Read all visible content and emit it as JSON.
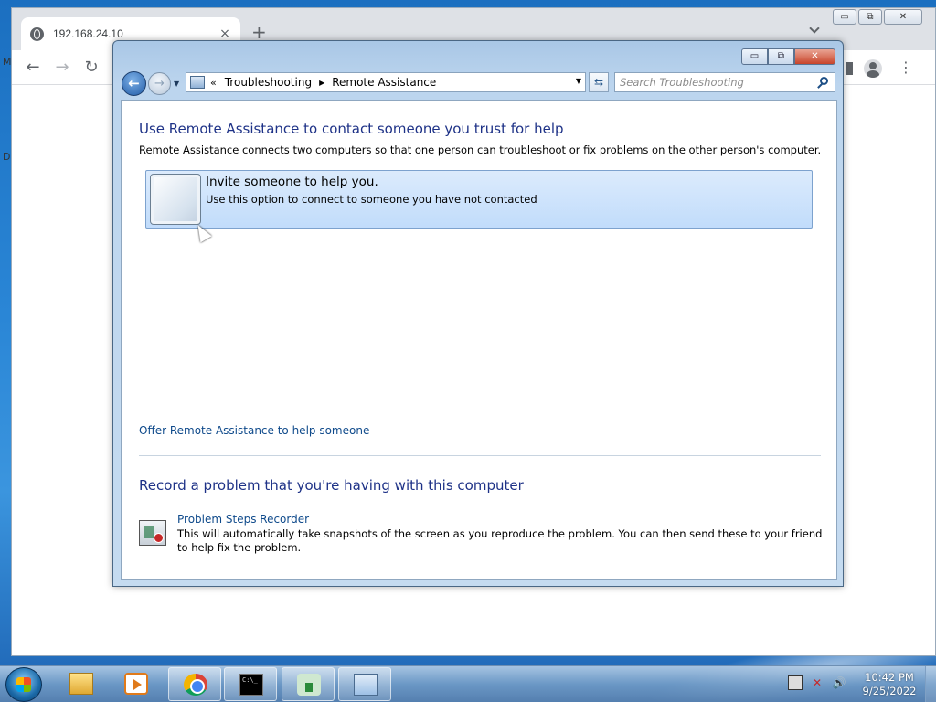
{
  "browser": {
    "tab_title": "192.168.24.10",
    "tab_close": "×",
    "new_tab": "+",
    "tab_search": "",
    "back": "←",
    "forward": "→",
    "reload": "↻",
    "menu": "⋮",
    "edge_letters": [
      "M",
      "D"
    ],
    "window_controls": {
      "minimize": "▭",
      "maximize": "⧉",
      "close": "✕"
    }
  },
  "explorer": {
    "window_controls": {
      "minimize": "▭",
      "maximize": "⧉",
      "close": "✕"
    },
    "back_glyph": "←",
    "forward_glyph": "→",
    "history_dropdown": "▼",
    "address": {
      "overflow": "«",
      "crumbs": [
        "Troubleshooting",
        "Remote Assistance"
      ],
      "separator": "▶",
      "dropdown": "▼"
    },
    "refresh_glyph": "⇆",
    "search": {
      "placeholder": "Search Troubleshooting",
      "value": ""
    },
    "content": {
      "heading": "Use Remote Assistance to contact someone you trust for help",
      "description": "Remote Assistance connects two computers so that one person can troubleshoot or fix problems on the other person's computer.",
      "invite": {
        "title": "Invite someone to help you.",
        "subtitle": "Use this option to connect to someone you have not contacted"
      },
      "offer_link": "Offer Remote Assistance to help someone",
      "record_heading": "Record a problem that you're having with this computer",
      "psr_link": "Problem Steps Recorder",
      "psr_description": "This will automatically take snapshots of the screen as you reproduce the problem. You can then send these to your friend to help fix the problem."
    }
  },
  "taskbar": {
    "items": [
      {
        "name": "windows-explorer",
        "icon": "folder-icon",
        "active": false
      },
      {
        "name": "media-player",
        "icon": "media-player-icon",
        "active": false
      },
      {
        "name": "google-chrome",
        "icon": "chrome-icon",
        "active": true
      },
      {
        "name": "command-prompt",
        "icon": "cmd-icon",
        "active": true
      },
      {
        "name": "gecko-app",
        "icon": "gecko-icon",
        "active": true
      },
      {
        "name": "control-panel",
        "icon": "control-panel-icon",
        "active": true
      }
    ],
    "clock": {
      "time": "10:42 PM",
      "date": "9/25/2022"
    }
  }
}
